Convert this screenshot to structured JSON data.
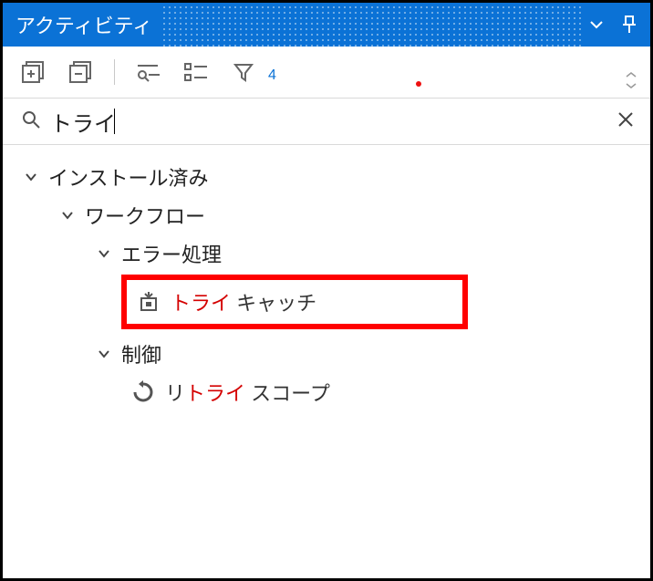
{
  "panel": {
    "title": "アクティビティ"
  },
  "toolbar": {
    "filter_count": "4"
  },
  "search": {
    "value": "トライ"
  },
  "tree": {
    "root": {
      "label": "インストール済み"
    },
    "workflow": {
      "label": "ワークフロー"
    },
    "error": {
      "label": "エラー処理"
    },
    "trycatch": {
      "match": "トライ",
      "rest": " キャッチ"
    },
    "control": {
      "label": "制御"
    },
    "retry": {
      "pre": "リ",
      "match": "トライ",
      "rest": " スコープ"
    }
  }
}
